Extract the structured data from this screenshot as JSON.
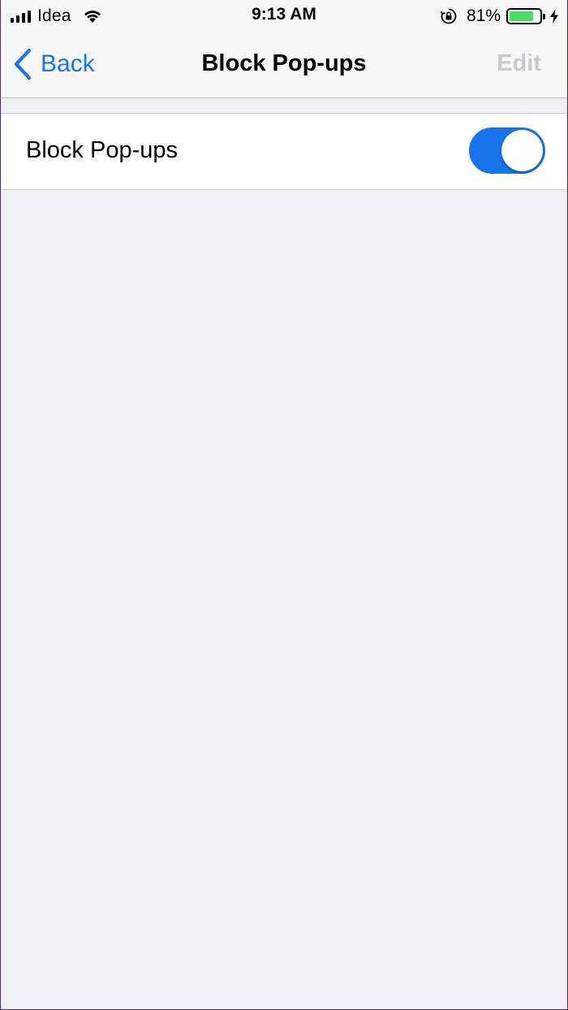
{
  "status_bar": {
    "carrier": "Idea",
    "time": "9:13 AM",
    "battery_percent": "81%",
    "battery_level": 0.81,
    "icons": [
      "signal-icon",
      "wifi-icon",
      "rotation-lock-icon",
      "battery-icon",
      "charging-bolt-icon"
    ]
  },
  "nav": {
    "back_label": "Back",
    "title": "Block Pop-ups",
    "edit_label": "Edit"
  },
  "settings": {
    "block_popups_label": "Block Pop-ups",
    "block_popups_on": true
  },
  "colors": {
    "accent": "#1a73e8",
    "background": "#efeff4",
    "battery": "#4cd964",
    "disabled": "#c9c9ce"
  }
}
